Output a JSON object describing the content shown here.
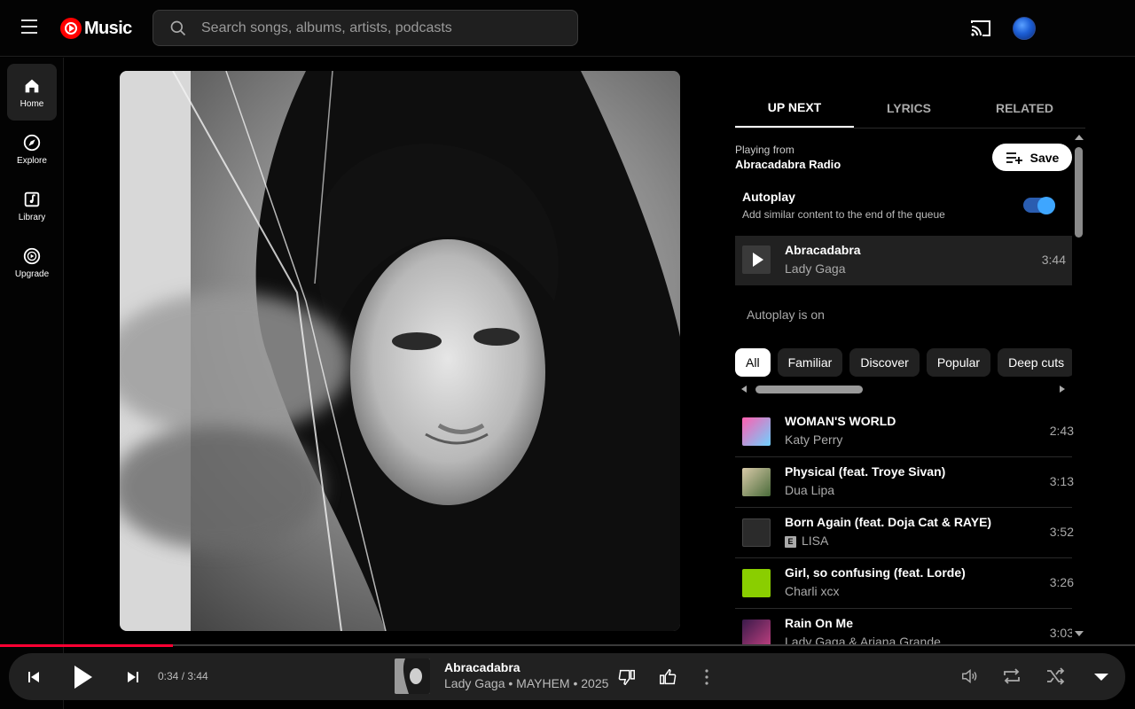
{
  "header": {
    "logo_text": "Music",
    "search_placeholder": "Search songs, albums, artists, podcasts"
  },
  "sidebar": {
    "items": [
      {
        "label": "Home",
        "icon": "home-icon",
        "active": true
      },
      {
        "label": "Explore",
        "icon": "compass-icon"
      },
      {
        "label": "Library",
        "icon": "library-icon"
      },
      {
        "label": "Upgrade",
        "icon": "upgrade-icon"
      }
    ]
  },
  "tabs": [
    {
      "label": "UP NEXT",
      "active": true
    },
    {
      "label": "LYRICS"
    },
    {
      "label": "RELATED"
    }
  ],
  "queue_header": {
    "playing_from_label": "Playing from",
    "playing_from_name": "Abracadabra Radio",
    "save_label": "Save"
  },
  "autoplay": {
    "title": "Autoplay",
    "description": "Add similar content to the end of the queue",
    "enabled": true,
    "status_text": "Autoplay is on"
  },
  "current_track": {
    "title": "Abracadabra",
    "artist": "Lady Gaga",
    "duration": "3:44"
  },
  "chips": [
    {
      "label": "All",
      "active": true
    },
    {
      "label": "Familiar"
    },
    {
      "label": "Discover"
    },
    {
      "label": "Popular"
    },
    {
      "label": "Deep cuts"
    }
  ],
  "queue": [
    {
      "title": "WOMAN'S WORLD",
      "artist": "Katy Perry",
      "duration": "2:43",
      "explicit": false
    },
    {
      "title": "Physical (feat. Troye Sivan)",
      "artist": "Dua Lipa",
      "duration": "3:13",
      "explicit": false
    },
    {
      "title": "Born Again (feat. Doja Cat & RAYE)",
      "artist": "LISA",
      "duration": "3:52",
      "explicit": true,
      "explicit_badge": "E"
    },
    {
      "title": "Girl, so confusing (feat. Lorde)",
      "artist": "Charli xcx",
      "duration": "3:26",
      "explicit": false
    },
    {
      "title": "Rain On Me",
      "artist": "Lady Gaga & Ariana Grande",
      "duration": "3:03",
      "explicit": false
    }
  ],
  "player": {
    "time": "0:34 / 3:44",
    "progress_fraction": 0.152,
    "title": "Abracadabra",
    "meta": "Lady Gaga • MAYHEM • 2025"
  },
  "colors": {
    "accent": "#ff0033",
    "toggle": "#3ea6ff",
    "background": "#030303"
  }
}
